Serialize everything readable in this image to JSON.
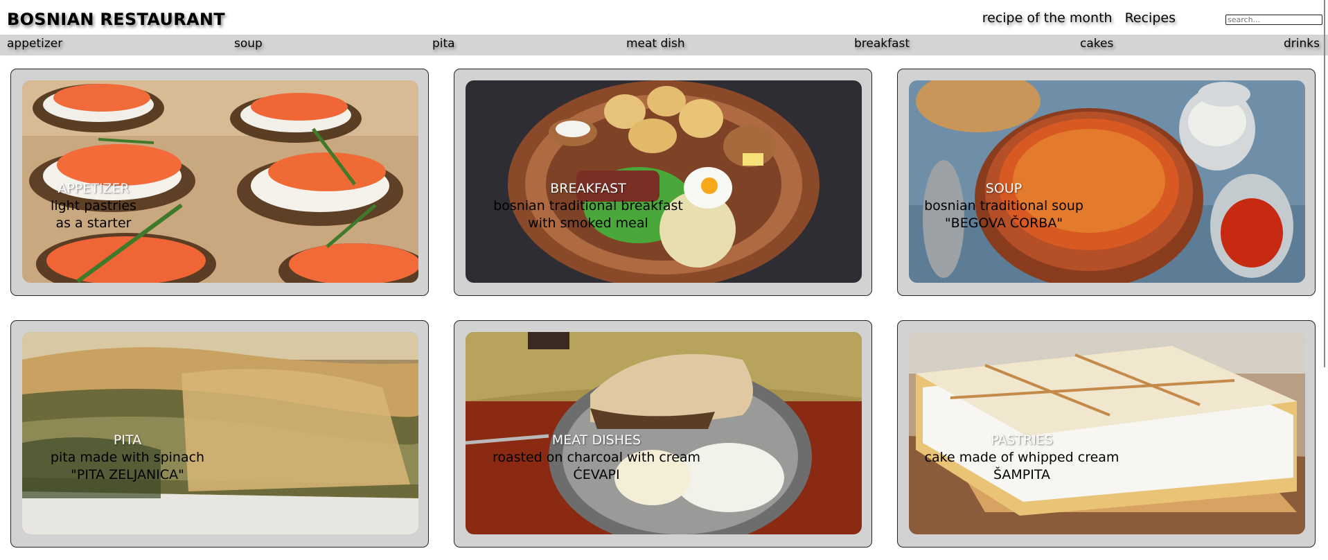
{
  "header": {
    "logo": "BOSNIAN RESTAURANT",
    "links": [
      "recipe of the month",
      "Recipes"
    ],
    "search_placeholder": "search..."
  },
  "nav": [
    "appetizer",
    "soup",
    "pita",
    "meat dish",
    "breakfast",
    "cakes",
    "drinks"
  ],
  "cards": [
    {
      "title": "APPETIZER",
      "line1": "light pastries",
      "line2": "as a starter",
      "image": "smoked salmon canapes"
    },
    {
      "title": "BREAKFAST",
      "line1": "bosnian traditional breakfast",
      "line2": "with smoked meal",
      "image": "breakfast platter on copper tray"
    },
    {
      "title": "SOUP",
      "line1": "bosnian traditional soup",
      "line2": "\"BEGOVA ČORBA\"",
      "image": "soup in clay bowl"
    },
    {
      "title": "PITA",
      "line1": "pita made with spinach",
      "line2": "\"PITA ZELJANICA\"",
      "image": "spinach pie"
    },
    {
      "title": "MEAT DISHES",
      "line1": "roasted on charcoal with cream",
      "line2": "ĆEVAPI",
      "image": "cevapi with onion and cream"
    },
    {
      "title": "PASTRIES",
      "line1": "cake made of whipped cream",
      "line2": "ŠAMPITA",
      "image": "whipped cream cake slices"
    }
  ]
}
